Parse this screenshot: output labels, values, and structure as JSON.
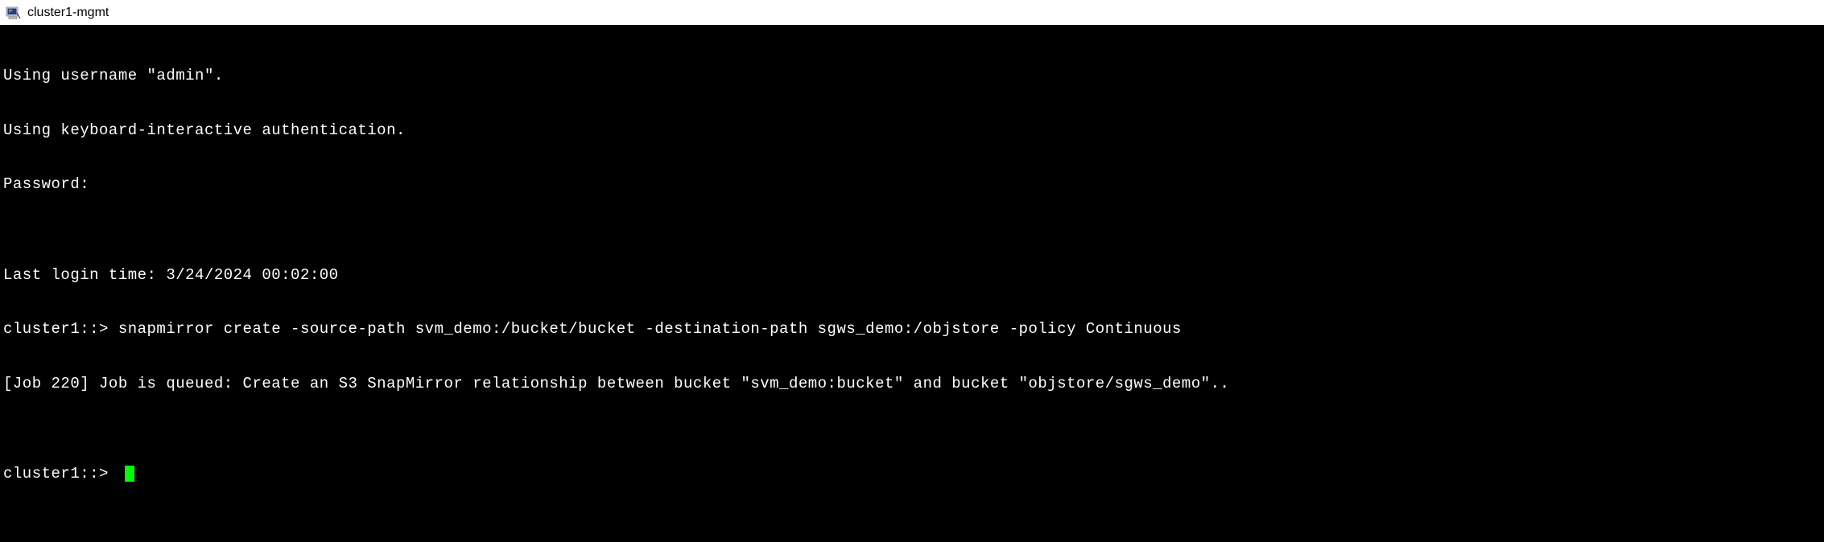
{
  "window": {
    "title": "cluster1-mgmt"
  },
  "terminal": {
    "lines": [
      "Using username \"admin\".",
      "Using keyboard-interactive authentication.",
      "Password:",
      "",
      "Last login time: 3/24/2024 00:02:00",
      "cluster1::> snapmirror create -source-path svm_demo:/bucket/bucket -destination-path sgws_demo:/objstore -policy Continuous",
      "[Job 220] Job is queued: Create an S3 SnapMirror relationship between bucket \"svm_demo:bucket\" and bucket \"objstore/sgws_demo\"..",
      ""
    ],
    "prompt": "cluster1::> "
  }
}
